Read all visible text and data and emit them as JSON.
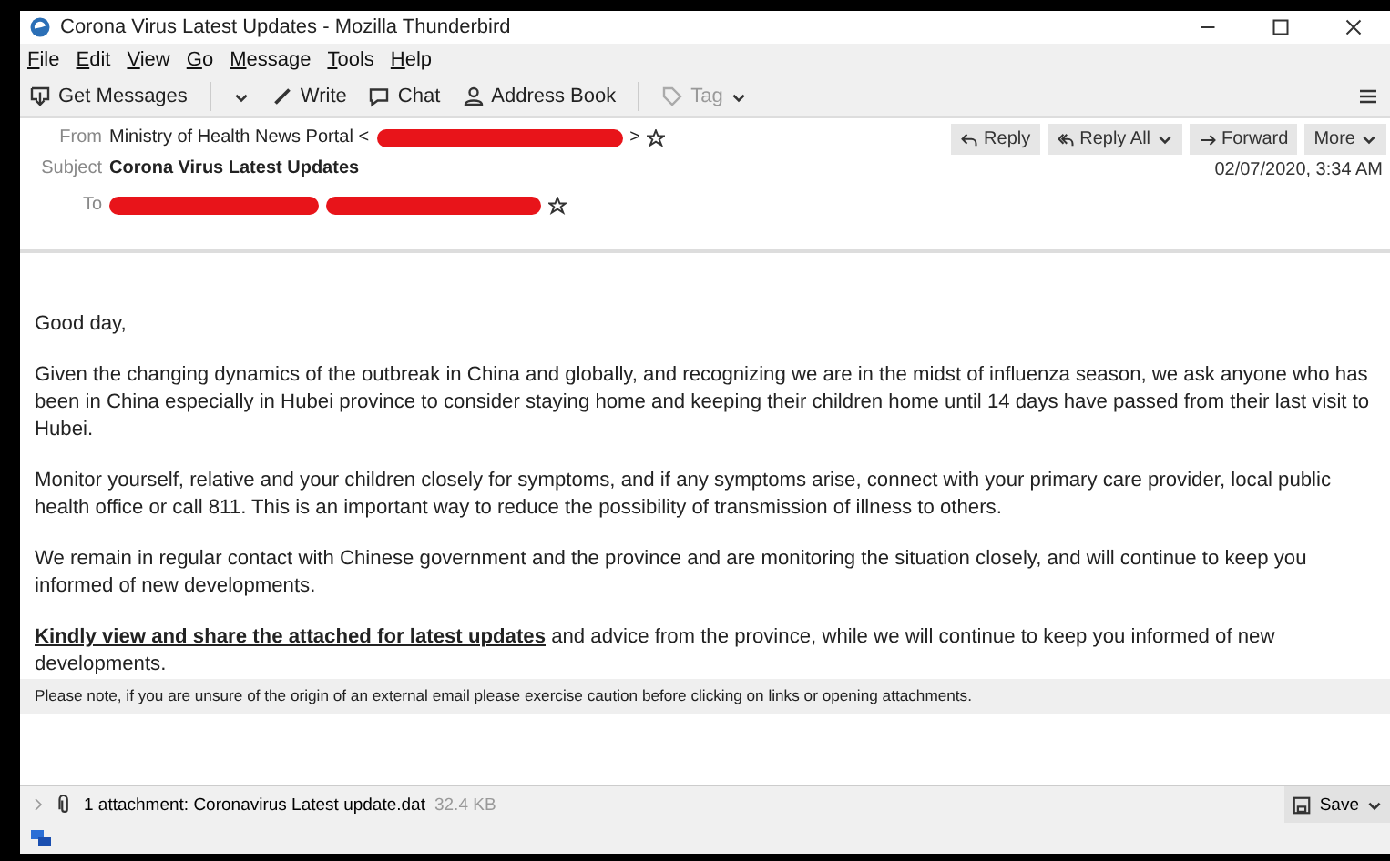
{
  "window": {
    "title": "Corona Virus Latest Updates - Mozilla Thunderbird"
  },
  "menu": [
    "File",
    "Edit",
    "View",
    "Go",
    "Message",
    "Tools",
    "Help"
  ],
  "toolbar": [
    {
      "kind": "split",
      "label": "Get Messages",
      "disabled": false
    },
    {
      "kind": "button",
      "label": "Write",
      "disabled": false
    },
    {
      "kind": "button",
      "label": "Chat",
      "disabled": false
    },
    {
      "kind": "button",
      "label": "Address Book",
      "disabled": false
    },
    {
      "kind": "dropdown",
      "label": "Tag",
      "disabled": true
    }
  ],
  "header": {
    "from": {
      "label": "From",
      "value": "Ministry of Health News Portal <",
      "after": ">"
    },
    "subject": {
      "label": "Subject",
      "value": "Corona Virus Latest Updates"
    },
    "to": {
      "label": "To"
    },
    "date": "02/07/2020, 3:34 AM",
    "actions": [
      {
        "kind": "reply",
        "label": "Reply"
      },
      {
        "kind": "reply_all",
        "label": "Reply All"
      },
      {
        "kind": "forward",
        "label": "Forward"
      },
      {
        "kind": "more",
        "label": "More"
      }
    ]
  },
  "body": [
    {
      "kind": "text",
      "text": "Good day,"
    },
    {
      "kind": "text",
      "text": "Given the changing dynamics of the outbreak in China and globally, and recognizing we are in the midst of influenza season, we ask anyone who has been in China especially in Hubei province to consider staying home and keeping their children home until 14 days have passed from their last visit to Hubei."
    },
    {
      "kind": "text",
      "text": "Monitor yourself, relative and your children closely for symptoms, and if any symptoms arise, connect with your primary care provider, local public health office or call 811. This is an important way to reduce the possibility of transmission of illness to others."
    },
    {
      "kind": "text",
      "text": "We remain in regular contact with Chinese government and the province and are monitoring the situation closely, and will continue to keep you informed of new developments."
    },
    {
      "kind": "link",
      "link": "Kindly view and share the attached for latest updates",
      "text": " and advice from the province, while we will continue to keep you informed of new developments."
    }
  ],
  "notice": "Please note, if you are unsure of the origin of an external email please exercise caution before clicking on links or opening attachments.",
  "attachment": {
    "expanded": false,
    "label": "1 attachment: Coronavirus Latest update.dat",
    "size": "32.4 KB",
    "save": "Save"
  }
}
